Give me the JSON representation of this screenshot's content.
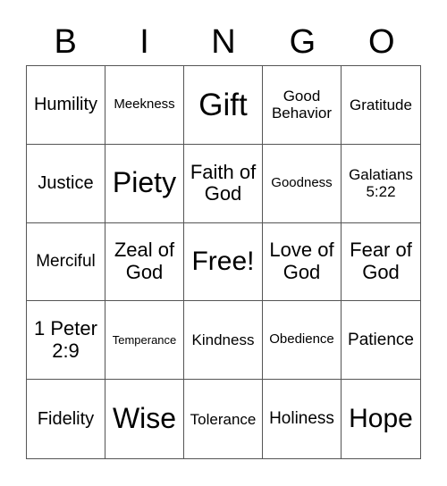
{
  "header": {
    "letters": [
      "B",
      "I",
      "N",
      "G",
      "O"
    ]
  },
  "card": {
    "rows": [
      [
        "Humility",
        "Meekness",
        "Gift",
        "Good Behavior",
        "Gratitude"
      ],
      [
        "Justice",
        "Piety",
        "Faith of God",
        "Goodness",
        "Galatians 5:22"
      ],
      [
        "Merciful",
        "Zeal of God",
        "Free!",
        "Love of God",
        "Fear of God"
      ],
      [
        "1 Peter 2:9",
        "Temperance",
        "Kindness",
        "Obedience",
        "Patience"
      ],
      [
        "Fidelity",
        "Wise",
        "Tolerance",
        "Holiness",
        "Hope"
      ]
    ],
    "free_space": "Free!"
  }
}
